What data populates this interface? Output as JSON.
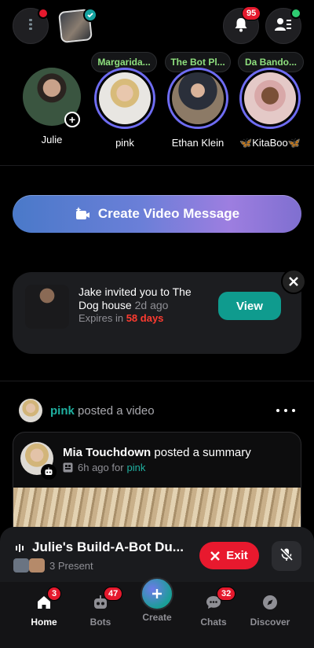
{
  "header": {
    "menu_icon": "menu-icon",
    "notifications_badge": "95",
    "contacts_icon": "contacts-icon"
  },
  "stories": [
    {
      "name": "Julie",
      "tag": ""
    },
    {
      "name": "pink",
      "tag": "Margarida..."
    },
    {
      "name": "Ethan Klein",
      "tag": "The Bot Pl..."
    },
    {
      "name": "🦋KitaBoo🦋",
      "tag": "Da Bando..."
    }
  ],
  "cta": {
    "label": "Create Video Message"
  },
  "invite": {
    "message": "Jake invited you to The Dog house",
    "time": "2d ago",
    "expires_prefix": "Expires in",
    "expires_value": "58 days",
    "view_label": "View"
  },
  "feed": {
    "poster_name": "pink",
    "poster_action": "posted a video",
    "card_author": "Mia Touchdown",
    "card_action": "posted a summary",
    "card_time": "6h ago for",
    "card_for": "pink"
  },
  "call": {
    "title": "Julie's Build-A-Bot Du...",
    "present": "3 Present",
    "exit_label": "Exit"
  },
  "tabs": [
    {
      "label": "Home",
      "badge": "3"
    },
    {
      "label": "Bots",
      "badge": "47"
    },
    {
      "label": "Create",
      "badge": ""
    },
    {
      "label": "Chats",
      "badge": "32"
    },
    {
      "label": "Discover",
      "badge": ""
    }
  ],
  "colors": {
    "accent_teal": "#0f9b8e",
    "danger_red": "#e8192e",
    "story_ring": "#6e6cf2",
    "tag_green": "#8fe07e",
    "expires_red": "#ff3b30"
  }
}
